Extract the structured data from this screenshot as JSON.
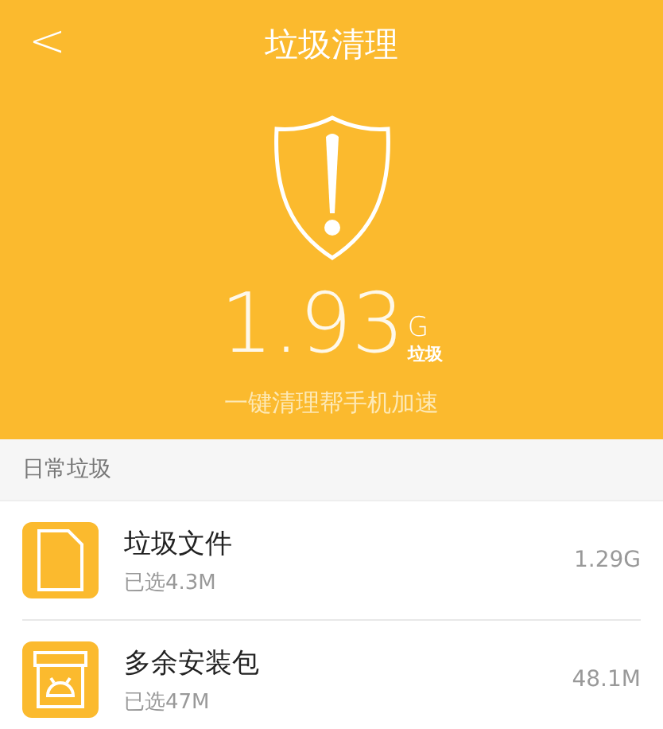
{
  "header": {
    "back": "<",
    "title": "垃圾清理",
    "amount": "1.93",
    "unit": "G",
    "unit_label": "垃圾",
    "subtitle": "一键清理帮手机加速"
  },
  "section": {
    "title": "日常垃圾"
  },
  "items": [
    {
      "kind": "file",
      "name": "垃圾文件",
      "selected_text": "已选4.3M",
      "size": "1.29G"
    },
    {
      "kind": "package",
      "name": "多余安装包",
      "selected_text": "已选47M",
      "size": "48.1M"
    }
  ]
}
